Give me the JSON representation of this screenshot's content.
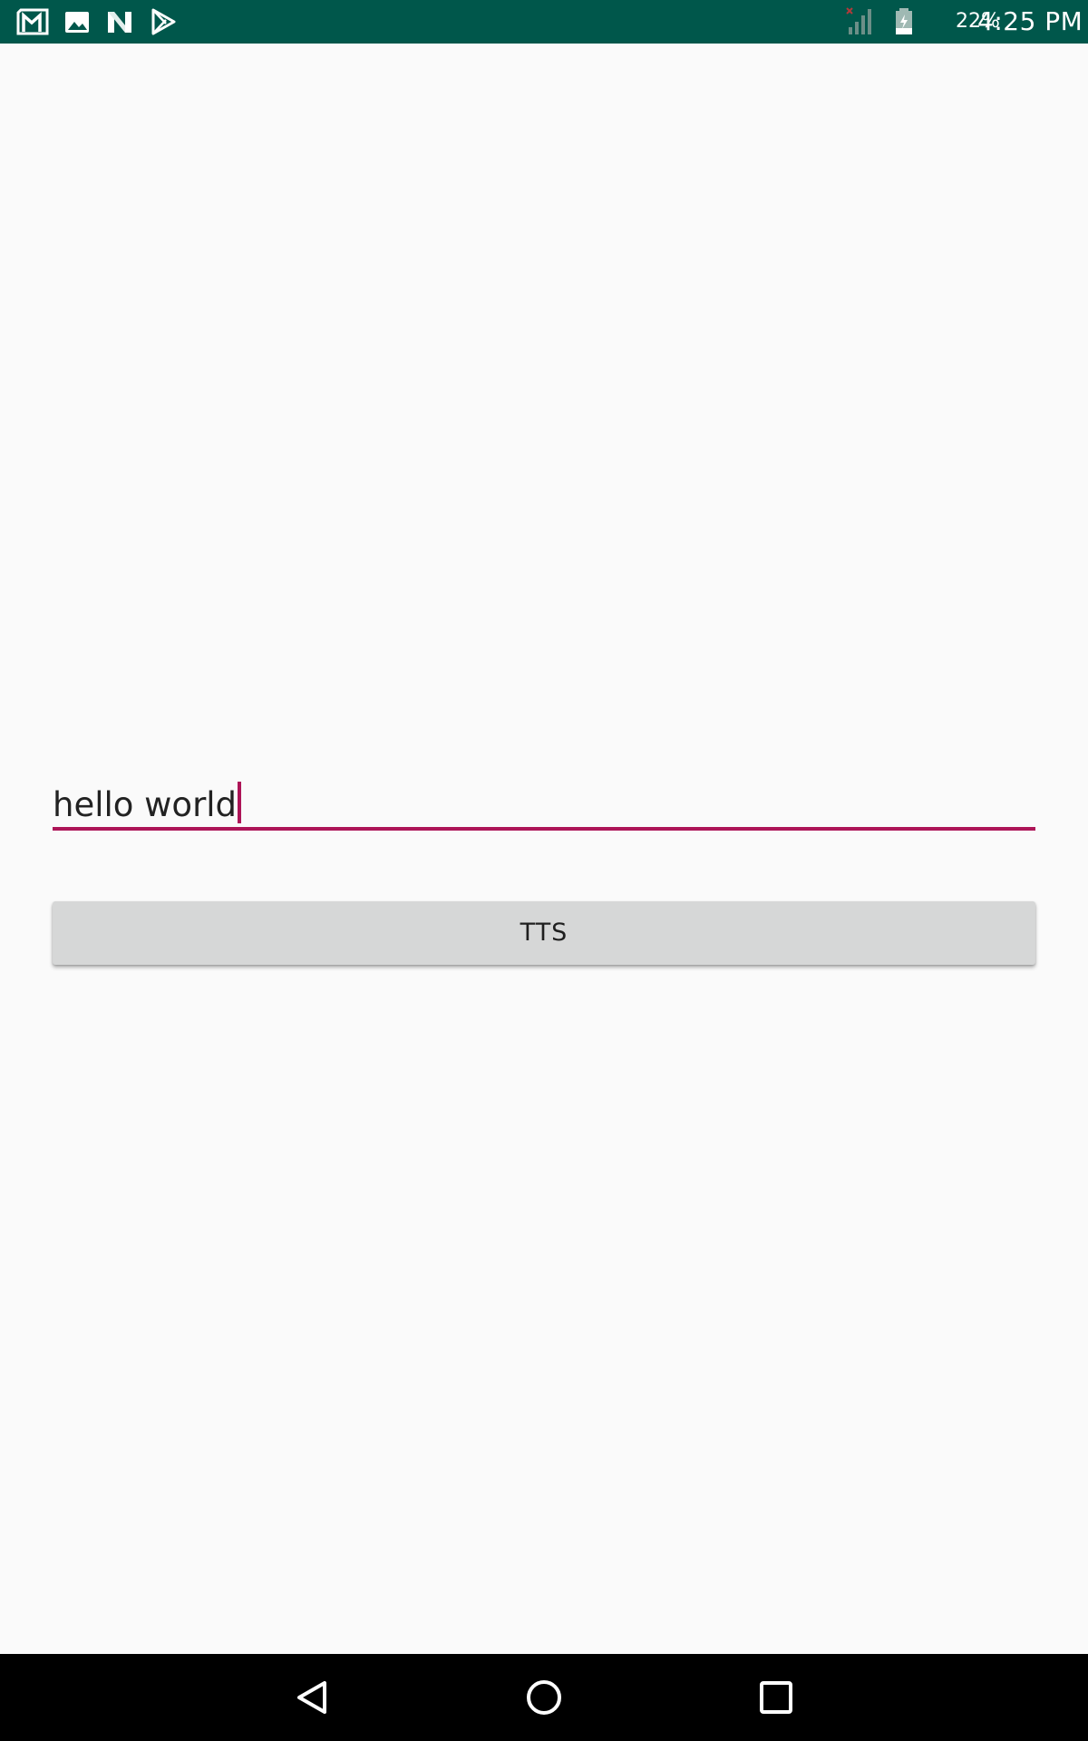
{
  "status_bar": {
    "background": "#00574b",
    "notification_icons": [
      "gmail-icon",
      "photos-icon",
      "n-app-icon",
      "play-store-icon"
    ],
    "signal_icon": "cell-signal-icon",
    "battery_icon": "battery-icon",
    "battery_percent": "22%",
    "clock": "4:25 PM"
  },
  "main": {
    "text_input": {
      "value": "hello world",
      "focused": true,
      "accent_color": "#ad1457"
    },
    "tts_button": {
      "label": "TTS"
    }
  },
  "nav_bar": {
    "buttons": [
      "back-icon",
      "home-icon",
      "recents-icon"
    ]
  }
}
